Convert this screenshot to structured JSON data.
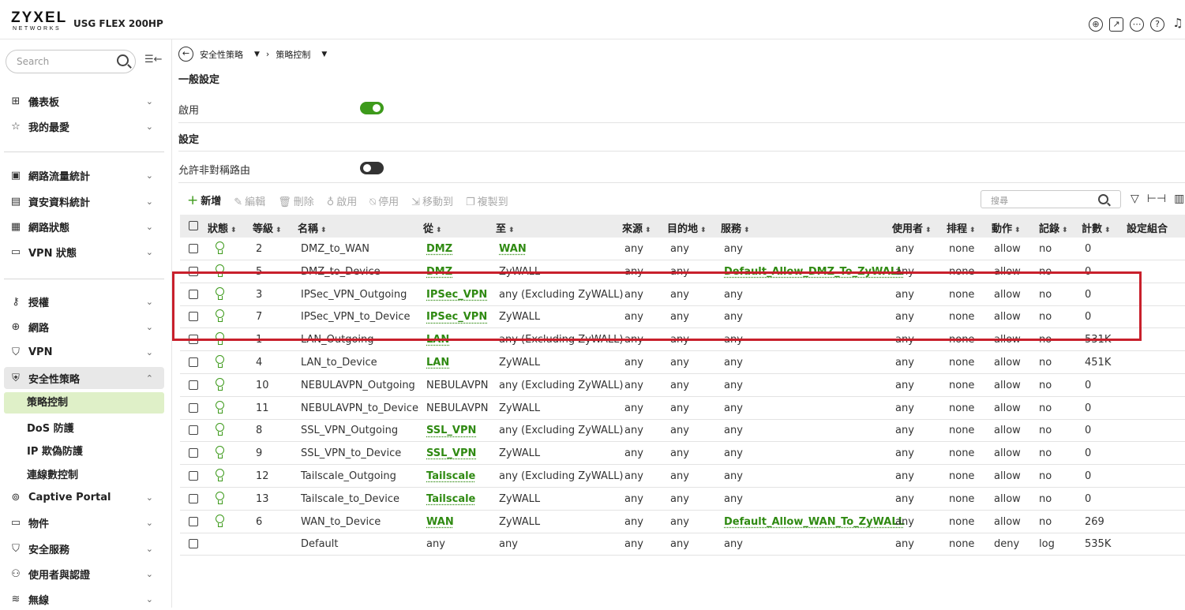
{
  "header": {
    "logo_main": "ZYXEL",
    "logo_sub": "NETWORKS",
    "model": "USG FLEX 200HP",
    "icons": [
      "globe-icon",
      "chart-icon",
      "more-icon",
      "help-icon",
      "bell-icon"
    ]
  },
  "sidebar": {
    "search_placeholder": "Search",
    "collapse_icon": "collapse-icon",
    "items": [
      {
        "icon": "⊞",
        "label": "儀表板"
      },
      {
        "icon": "☆",
        "label": "我的最愛"
      },
      {
        "icon": "▣",
        "label": "網路流量統計"
      },
      {
        "icon": "▤",
        "label": "資安資料統計"
      },
      {
        "icon": "▦",
        "label": "網路狀態"
      },
      {
        "icon": "▭",
        "label": "VPN 狀態"
      },
      {
        "icon": "⚷",
        "label": "授權"
      },
      {
        "icon": "⊕",
        "label": "網路"
      },
      {
        "icon": "⛉",
        "label": "VPN"
      },
      {
        "icon": "⛨",
        "label": "安全性策略"
      },
      {
        "icon": "⊚",
        "label": "Captive Portal"
      },
      {
        "icon": "▭",
        "label": "物件"
      },
      {
        "icon": "⛉",
        "label": "安全服務"
      },
      {
        "icon": "⚇",
        "label": "使用者與認證"
      },
      {
        "icon": "≋",
        "label": "無線"
      }
    ],
    "sub_items": [
      "策略控制",
      "DoS 防護",
      "IP 欺偽防護",
      "連線數控制"
    ]
  },
  "breadcrumb": {
    "level1": "安全性策略",
    "level2": "策略控制"
  },
  "general": {
    "title": "一般設定",
    "enable_label": "啟用",
    "enable_on": true
  },
  "settings": {
    "title": "設定",
    "asym_label": "允許非對稱路由",
    "asym_on": false
  },
  "toolbar": {
    "add": "新增",
    "edit": "編輯",
    "delete": "刪除",
    "activate": "啟用",
    "deactivate": "停用",
    "move_to": "移動到",
    "copy_to": "複製到",
    "search_placeholder": "搜尋"
  },
  "table": {
    "headers": [
      "狀態",
      "等級",
      "名稱",
      "從",
      "至",
      "來源",
      "目的地",
      "服務",
      "使用者",
      "排程",
      "動作",
      "記錄",
      "計數",
      "設定組合"
    ],
    "rows": [
      {
        "status": true,
        "level": "2",
        "name": "DMZ_to_WAN",
        "from": "DMZ",
        "from_link": true,
        "to": "WAN",
        "to_link": true,
        "source": "any",
        "dest": "any",
        "service": "any",
        "service_link": false,
        "user": "any",
        "schedule": "none",
        "action": "allow",
        "log": "no",
        "count": "0"
      },
      {
        "status": true,
        "level": "5",
        "name": "DMZ_to_Device",
        "from": "DMZ",
        "from_link": true,
        "to": "ZyWALL",
        "to_link": false,
        "source": "any",
        "dest": "any",
        "service": "Default_Allow_DMZ_To_ZyWALL",
        "service_link": true,
        "user": "any",
        "schedule": "none",
        "action": "allow",
        "log": "no",
        "count": "0"
      },
      {
        "status": true,
        "level": "3",
        "name": "IPSec_VPN_Outgoing",
        "from": "IPSec_VPN",
        "from_link": true,
        "to": "any (Excluding ZyWALL)",
        "to_link": false,
        "source": "any",
        "dest": "any",
        "service": "any",
        "service_link": false,
        "user": "any",
        "schedule": "none",
        "action": "allow",
        "log": "no",
        "count": "0"
      },
      {
        "status": true,
        "level": "7",
        "name": "IPSec_VPN_to_Device",
        "from": "IPSec_VPN",
        "from_link": true,
        "to": "ZyWALL",
        "to_link": false,
        "source": "any",
        "dest": "any",
        "service": "any",
        "service_link": false,
        "user": "any",
        "schedule": "none",
        "action": "allow",
        "log": "no",
        "count": "0"
      },
      {
        "status": true,
        "level": "1",
        "name": "LAN_Outgoing",
        "from": "LAN",
        "from_link": true,
        "to": "any (Excluding ZyWALL)",
        "to_link": false,
        "source": "any",
        "dest": "any",
        "service": "any",
        "service_link": false,
        "user": "any",
        "schedule": "none",
        "action": "allow",
        "log": "no",
        "count": "531K"
      },
      {
        "status": true,
        "level": "4",
        "name": "LAN_to_Device",
        "from": "LAN",
        "from_link": true,
        "to": "ZyWALL",
        "to_link": false,
        "source": "any",
        "dest": "any",
        "service": "any",
        "service_link": false,
        "user": "any",
        "schedule": "none",
        "action": "allow",
        "log": "no",
        "count": "451K"
      },
      {
        "status": true,
        "level": "10",
        "name": "NEBULAVPN_Outgoing",
        "from": "NEBULAVPN",
        "from_link": false,
        "to": "any (Excluding ZyWALL)",
        "to_link": false,
        "source": "any",
        "dest": "any",
        "service": "any",
        "service_link": false,
        "user": "any",
        "schedule": "none",
        "action": "allow",
        "log": "no",
        "count": "0"
      },
      {
        "status": true,
        "level": "11",
        "name": "NEBULAVPN_to_Device",
        "from": "NEBULAVPN",
        "from_link": false,
        "to": "ZyWALL",
        "to_link": false,
        "source": "any",
        "dest": "any",
        "service": "any",
        "service_link": false,
        "user": "any",
        "schedule": "none",
        "action": "allow",
        "log": "no",
        "count": "0"
      },
      {
        "status": true,
        "level": "8",
        "name": "SSL_VPN_Outgoing",
        "from": "SSL_VPN",
        "from_link": true,
        "to": "any (Excluding ZyWALL)",
        "to_link": false,
        "source": "any",
        "dest": "any",
        "service": "any",
        "service_link": false,
        "user": "any",
        "schedule": "none",
        "action": "allow",
        "log": "no",
        "count": "0"
      },
      {
        "status": true,
        "level": "9",
        "name": "SSL_VPN_to_Device",
        "from": "SSL_VPN",
        "from_link": true,
        "to": "ZyWALL",
        "to_link": false,
        "source": "any",
        "dest": "any",
        "service": "any",
        "service_link": false,
        "user": "any",
        "schedule": "none",
        "action": "allow",
        "log": "no",
        "count": "0"
      },
      {
        "status": true,
        "level": "12",
        "name": "Tailscale_Outgoing",
        "from": "Tailscale",
        "from_link": true,
        "to": "any (Excluding ZyWALL)",
        "to_link": false,
        "source": "any",
        "dest": "any",
        "service": "any",
        "service_link": false,
        "user": "any",
        "schedule": "none",
        "action": "allow",
        "log": "no",
        "count": "0"
      },
      {
        "status": true,
        "level": "13",
        "name": "Tailscale_to_Device",
        "from": "Tailscale",
        "from_link": true,
        "to": "ZyWALL",
        "to_link": false,
        "source": "any",
        "dest": "any",
        "service": "any",
        "service_link": false,
        "user": "any",
        "schedule": "none",
        "action": "allow",
        "log": "no",
        "count": "0"
      },
      {
        "status": true,
        "level": "6",
        "name": "WAN_to_Device",
        "from": "WAN",
        "from_link": true,
        "to": "ZyWALL",
        "to_link": false,
        "source": "any",
        "dest": "any",
        "service": "Default_Allow_WAN_To_ZyWALL",
        "service_link": true,
        "user": "any",
        "schedule": "none",
        "action": "allow",
        "log": "no",
        "count": "269"
      },
      {
        "status": false,
        "level": "",
        "name": "Default",
        "from": "any",
        "from_link": false,
        "to": "any",
        "to_link": false,
        "source": "any",
        "dest": "any",
        "service": "any",
        "service_link": false,
        "user": "any",
        "schedule": "none",
        "action": "deny",
        "log": "log",
        "count": "535K"
      }
    ]
  },
  "colors": {
    "accent": "#3d9a1b",
    "highlight": "#c8202c",
    "selected_bg": "#dff0c8"
  }
}
